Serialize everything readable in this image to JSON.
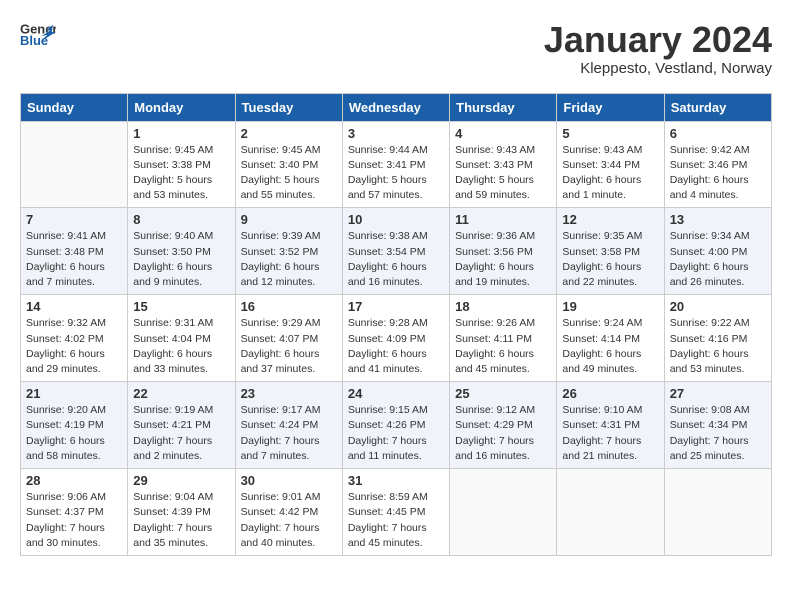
{
  "header": {
    "logo_line1": "General",
    "logo_line2": "Blue",
    "month_title": "January 2024",
    "location": "Kleppesto, Vestland, Norway"
  },
  "days_of_week": [
    "Sunday",
    "Monday",
    "Tuesday",
    "Wednesday",
    "Thursday",
    "Friday",
    "Saturday"
  ],
  "weeks": [
    [
      {
        "day": "",
        "info": ""
      },
      {
        "day": "1",
        "info": "Sunrise: 9:45 AM\nSunset: 3:38 PM\nDaylight: 5 hours\nand 53 minutes."
      },
      {
        "day": "2",
        "info": "Sunrise: 9:45 AM\nSunset: 3:40 PM\nDaylight: 5 hours\nand 55 minutes."
      },
      {
        "day": "3",
        "info": "Sunrise: 9:44 AM\nSunset: 3:41 PM\nDaylight: 5 hours\nand 57 minutes."
      },
      {
        "day": "4",
        "info": "Sunrise: 9:43 AM\nSunset: 3:43 PM\nDaylight: 5 hours\nand 59 minutes."
      },
      {
        "day": "5",
        "info": "Sunrise: 9:43 AM\nSunset: 3:44 PM\nDaylight: 6 hours\nand 1 minute."
      },
      {
        "day": "6",
        "info": "Sunrise: 9:42 AM\nSunset: 3:46 PM\nDaylight: 6 hours\nand 4 minutes."
      }
    ],
    [
      {
        "day": "7",
        "info": "Sunrise: 9:41 AM\nSunset: 3:48 PM\nDaylight: 6 hours\nand 7 minutes."
      },
      {
        "day": "8",
        "info": "Sunrise: 9:40 AM\nSunset: 3:50 PM\nDaylight: 6 hours\nand 9 minutes."
      },
      {
        "day": "9",
        "info": "Sunrise: 9:39 AM\nSunset: 3:52 PM\nDaylight: 6 hours\nand 12 minutes."
      },
      {
        "day": "10",
        "info": "Sunrise: 9:38 AM\nSunset: 3:54 PM\nDaylight: 6 hours\nand 16 minutes."
      },
      {
        "day": "11",
        "info": "Sunrise: 9:36 AM\nSunset: 3:56 PM\nDaylight: 6 hours\nand 19 minutes."
      },
      {
        "day": "12",
        "info": "Sunrise: 9:35 AM\nSunset: 3:58 PM\nDaylight: 6 hours\nand 22 minutes."
      },
      {
        "day": "13",
        "info": "Sunrise: 9:34 AM\nSunset: 4:00 PM\nDaylight: 6 hours\nand 26 minutes."
      }
    ],
    [
      {
        "day": "14",
        "info": "Sunrise: 9:32 AM\nSunset: 4:02 PM\nDaylight: 6 hours\nand 29 minutes."
      },
      {
        "day": "15",
        "info": "Sunrise: 9:31 AM\nSunset: 4:04 PM\nDaylight: 6 hours\nand 33 minutes."
      },
      {
        "day": "16",
        "info": "Sunrise: 9:29 AM\nSunset: 4:07 PM\nDaylight: 6 hours\nand 37 minutes."
      },
      {
        "day": "17",
        "info": "Sunrise: 9:28 AM\nSunset: 4:09 PM\nDaylight: 6 hours\nand 41 minutes."
      },
      {
        "day": "18",
        "info": "Sunrise: 9:26 AM\nSunset: 4:11 PM\nDaylight: 6 hours\nand 45 minutes."
      },
      {
        "day": "19",
        "info": "Sunrise: 9:24 AM\nSunset: 4:14 PM\nDaylight: 6 hours\nand 49 minutes."
      },
      {
        "day": "20",
        "info": "Sunrise: 9:22 AM\nSunset: 4:16 PM\nDaylight: 6 hours\nand 53 minutes."
      }
    ],
    [
      {
        "day": "21",
        "info": "Sunrise: 9:20 AM\nSunset: 4:19 PM\nDaylight: 6 hours\nand 58 minutes."
      },
      {
        "day": "22",
        "info": "Sunrise: 9:19 AM\nSunset: 4:21 PM\nDaylight: 7 hours\nand 2 minutes."
      },
      {
        "day": "23",
        "info": "Sunrise: 9:17 AM\nSunset: 4:24 PM\nDaylight: 7 hours\nand 7 minutes."
      },
      {
        "day": "24",
        "info": "Sunrise: 9:15 AM\nSunset: 4:26 PM\nDaylight: 7 hours\nand 11 minutes."
      },
      {
        "day": "25",
        "info": "Sunrise: 9:12 AM\nSunset: 4:29 PM\nDaylight: 7 hours\nand 16 minutes."
      },
      {
        "day": "26",
        "info": "Sunrise: 9:10 AM\nSunset: 4:31 PM\nDaylight: 7 hours\nand 21 minutes."
      },
      {
        "day": "27",
        "info": "Sunrise: 9:08 AM\nSunset: 4:34 PM\nDaylight: 7 hours\nand 25 minutes."
      }
    ],
    [
      {
        "day": "28",
        "info": "Sunrise: 9:06 AM\nSunset: 4:37 PM\nDaylight: 7 hours\nand 30 minutes."
      },
      {
        "day": "29",
        "info": "Sunrise: 9:04 AM\nSunset: 4:39 PM\nDaylight: 7 hours\nand 35 minutes."
      },
      {
        "day": "30",
        "info": "Sunrise: 9:01 AM\nSunset: 4:42 PM\nDaylight: 7 hours\nand 40 minutes."
      },
      {
        "day": "31",
        "info": "Sunrise: 8:59 AM\nSunset: 4:45 PM\nDaylight: 7 hours\nand 45 minutes."
      },
      {
        "day": "",
        "info": ""
      },
      {
        "day": "",
        "info": ""
      },
      {
        "day": "",
        "info": ""
      }
    ]
  ]
}
